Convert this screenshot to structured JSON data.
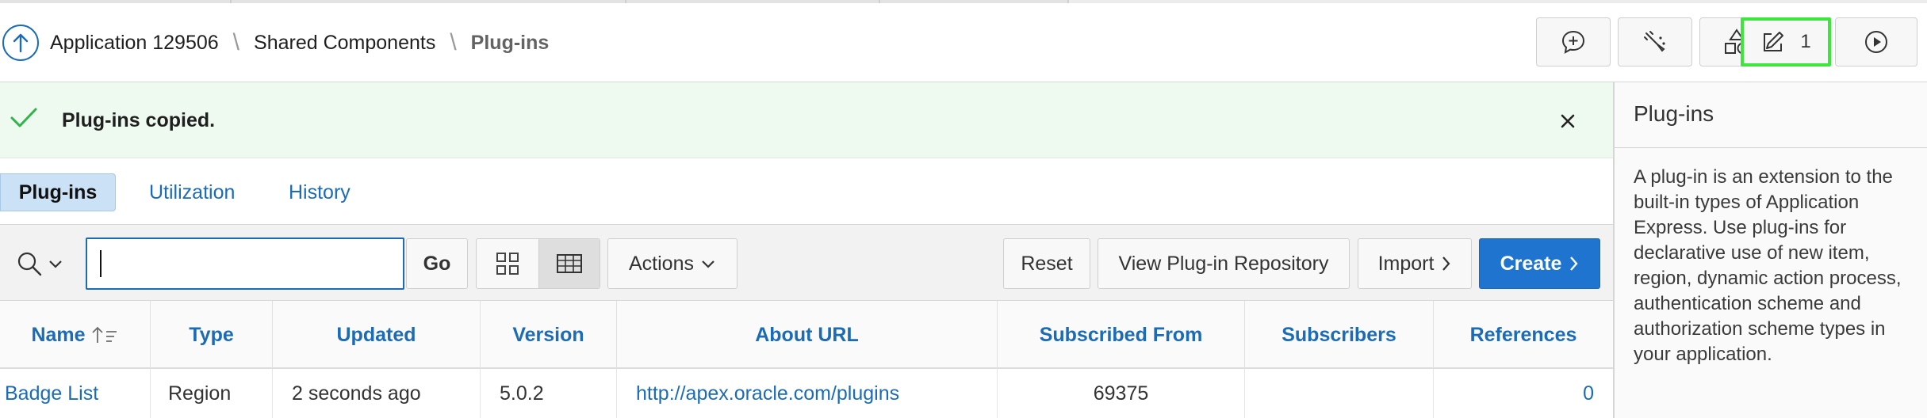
{
  "breadcrumb": {
    "items": [
      "Application 129506",
      "Shared Components"
    ],
    "current": "Plug-ins"
  },
  "header_toolbar": {
    "changes_count": "1"
  },
  "message": {
    "text": "Plug-ins copied."
  },
  "tabs": [
    {
      "label": "Plug-ins",
      "active": true
    },
    {
      "label": "Utilization",
      "active": false
    },
    {
      "label": "History",
      "active": false
    }
  ],
  "toolbar": {
    "search_value": "",
    "go_label": "Go",
    "actions_label": "Actions",
    "reset_label": "Reset",
    "repository_label": "View Plug-in Repository",
    "import_label": "Import",
    "create_label": "Create"
  },
  "table": {
    "columns": [
      "Name",
      "Type",
      "Updated",
      "Version",
      "About URL",
      "Subscribed From",
      "Subscribers",
      "References"
    ],
    "sort_column": "Name",
    "rows": [
      {
        "name": "Badge List",
        "type": "Region",
        "updated": "2 seconds ago",
        "version": "5.0.2",
        "about_url": "http://apex.oracle.com/plugins",
        "subscribed_from": "69375",
        "subscribers": "",
        "references": "0"
      }
    ]
  },
  "help": {
    "title": "Plug-ins",
    "body": "A plug-in is an extension to the built-in types of Application Express. Use plug-ins for declarative use of new item, region, dynamic action process, authentication scheme and authorization scheme types in your application."
  },
  "colors": {
    "accent": "#1b6bb5",
    "create_button": "#1f74cf",
    "success_bg": "#eefaef",
    "success_check": "#2fb34a",
    "focus_highlight": "#3de63d",
    "active_tab": "#cbe1f6"
  },
  "icons": [
    "arrow-up-icon",
    "feedback-icon",
    "brush-icon",
    "shapes-icon",
    "edit-icon",
    "play-icon",
    "check-icon",
    "close-icon",
    "search-icon",
    "chevron-down-icon",
    "grid-view-icon",
    "report-view-icon",
    "chevron-right-icon",
    "sort-asc-icon"
  ]
}
